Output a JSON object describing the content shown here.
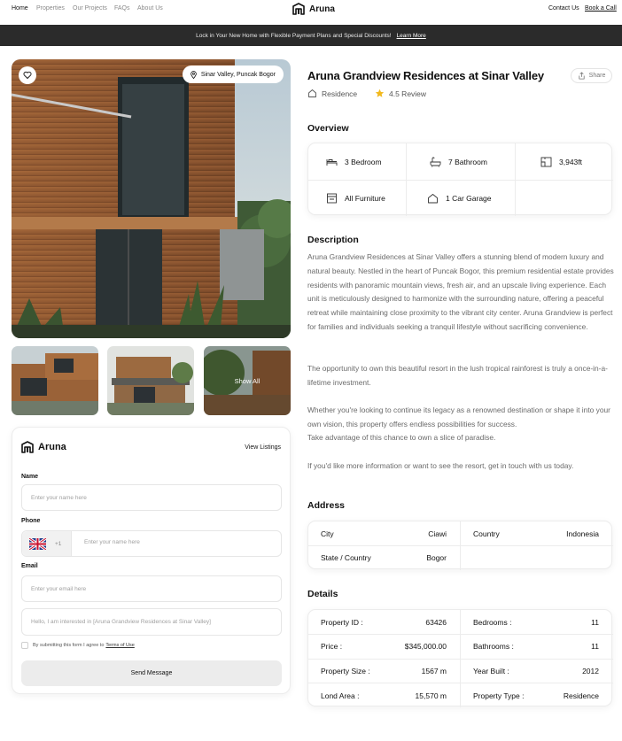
{
  "nav": {
    "links": [
      "Home",
      "Properties",
      "Our Projects",
      "FAQs",
      "About Us"
    ],
    "brand": "Aruna",
    "contact_label": "Contact Us",
    "book_label": "Book a Call"
  },
  "banner": {
    "text": "Lock in Your New Home with Flexible Payment Plans and Special Discounts!",
    "link": "Learn More"
  },
  "gallery": {
    "location": "Sinar Valley, Puncak Bogor",
    "show_all": "Show All",
    "favorite_icon": "heart-icon",
    "location_icon": "map-pin-icon"
  },
  "form": {
    "brand": "Aruna",
    "view_listings": "View Listings",
    "name_label": "Name",
    "name_placeholder": "Enter your name here",
    "phone_label": "Phone",
    "phone_code": "+1",
    "phone_placeholder": "Enter your name here",
    "email_label": "Email",
    "email_placeholder": "Enter your email here",
    "message_placeholder": "Hello, I am interested in [Aruna Grandview Residences at Sinar Valley]",
    "consent_text": "By submitting this form I agree to",
    "terms_link": "Terms of Use",
    "send_label": "Send Message"
  },
  "property": {
    "title": "Aruna Grandview Residences at Sinar Valley",
    "type": "Residence",
    "rating": "4.5 Review",
    "share": "Share"
  },
  "overview": {
    "heading": "Overview",
    "items": [
      {
        "icon": "bed-icon",
        "label": "3 Bedroom"
      },
      {
        "icon": "bathtub-icon",
        "label": "7 Bathroom"
      },
      {
        "icon": "area-icon",
        "label": "3,943ft"
      },
      {
        "icon": "furniture-icon",
        "label": "All Furniture"
      },
      {
        "icon": "garage-icon",
        "label": "1 Car Garage"
      }
    ]
  },
  "description": {
    "heading": "Description",
    "paragraphs": [
      "Aruna Grandview Residences at Sinar Valley offers a stunning blend of modern luxury and natural beauty. Nestled in the heart of Puncak Bogor, this premium residential estate provides residents with panoramic mountain views, fresh air, and an upscale living experience. Each unit is meticulously designed to harmonize with the surrounding nature, offering a peaceful retreat while maintaining close proximity to the vibrant city center. Aruna Grandview is perfect for families and individuals seeking a tranquil lifestyle without sacrificing convenience.",
      "The opportunity to own this beautiful resort in the lush tropical rainforest is truly a once-in-a-lifetime investment.",
      "Whether you're looking to continue its legacy as a renowned destination or shape it into your own vision, this property offers endless possibilities for success.",
      "Take advantage of this chance to own a slice of paradise.",
      "If you'd like more information or want to see the resort, get in touch with us today."
    ]
  },
  "address": {
    "heading": "Address",
    "city_label": "City",
    "city": "Ciawi",
    "country_label": "Country",
    "country": "Indonesia",
    "state_label": "State / Country",
    "state": "Bogor"
  },
  "details": {
    "heading": "Details",
    "rows": [
      {
        "l1": "Property ID :",
        "v1": "63426",
        "l2": "Bedrooms :",
        "v2": "11"
      },
      {
        "l1": "Price :",
        "v1": "$345,000.00",
        "l2": "Bathrooms :",
        "v2": "11"
      },
      {
        "l1": "Property Size :",
        "v1": "1567 m",
        "l2": "Year Built :",
        "v2": "2012"
      },
      {
        "l1": "Lond Area :",
        "v1": "15,570 m",
        "l2": "Property Type :",
        "v2": "Residence"
      }
    ]
  }
}
